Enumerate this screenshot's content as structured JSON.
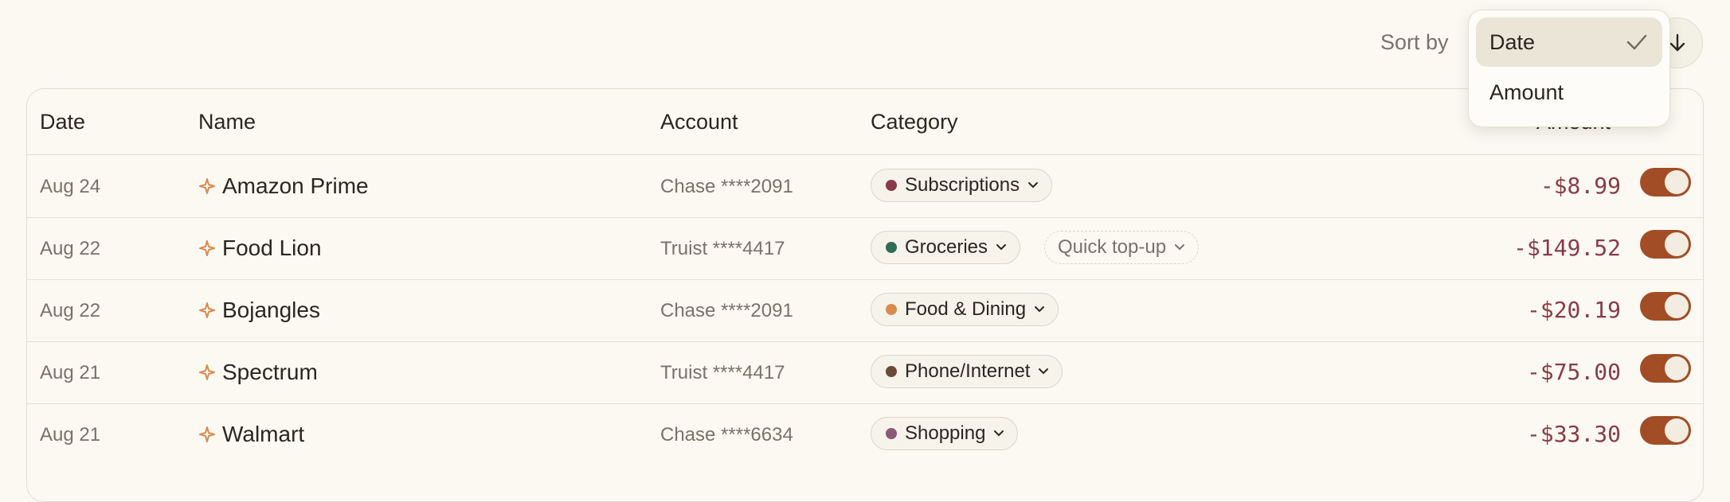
{
  "sort": {
    "label": "Sort by",
    "direction_icon": "arrow-down-icon",
    "options": [
      {
        "label": "Date",
        "selected": true
      },
      {
        "label": "Amount",
        "selected": false
      }
    ]
  },
  "table": {
    "headers": {
      "date": "Date",
      "name": "Name",
      "account": "Account",
      "category": "Category",
      "amount": "Amount"
    },
    "rows": [
      {
        "date": "Aug 24",
        "name": "Amazon Prime",
        "account": "Chase ****2091",
        "category": "Subscriptions",
        "category_color": "#8b3a47",
        "amount": "-$8.99",
        "included": true
      },
      {
        "date": "Aug 22",
        "name": "Food Lion",
        "account": "Truist ****4417",
        "category": "Groceries",
        "category_color": "#2f6e55",
        "extra_chip": "Quick top-up",
        "amount": "-$149.52",
        "included": true
      },
      {
        "date": "Aug 22",
        "name": "Bojangles",
        "account": "Chase ****2091",
        "category": "Food & Dining",
        "category_color": "#d98a4f",
        "amount": "-$20.19",
        "included": true
      },
      {
        "date": "Aug 21",
        "name": "Spectrum",
        "account": "Truist ****4417",
        "category": "Phone/Internet",
        "category_color": "#6b4a3a",
        "amount": "-$75.00",
        "included": true
      },
      {
        "date": "Aug 21",
        "name": "Walmart",
        "account": "Chase ****6634",
        "category": "Shopping",
        "category_color": "#8d5a78",
        "amount": "-$33.30",
        "included": true
      }
    ]
  },
  "colors": {
    "accent": "#a24d26",
    "amount": "#8a3b45",
    "sparkle": "#d98a4f"
  }
}
